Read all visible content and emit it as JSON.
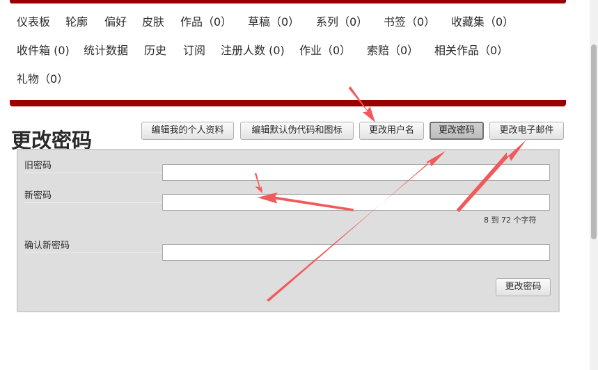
{
  "nav": {
    "row1": [
      "仪表板",
      "轮廓",
      "偏好",
      "皮肤",
      "作品（0）",
      "草稿（0）",
      "系列（0）",
      "书签（0）",
      "收藏集（0）"
    ],
    "row2": [
      "收件箱 (0)",
      "统计数据",
      "历史",
      "订阅",
      "注册人数 (0)",
      "作业（0）",
      "索赔（0）",
      "相关作品（0）"
    ],
    "row3": [
      "礼物（0）"
    ]
  },
  "page_title": "更改密码",
  "actions": {
    "edit_profile": "编辑我的个人资料",
    "edit_pseud": "编辑默认伪代码和图标",
    "change_username": "更改用户名",
    "change_password": "更改密码",
    "change_email": "更改电子邮件"
  },
  "form": {
    "old_password_label": "旧密码",
    "new_password_label": "新密码",
    "new_password_hint": "8 到 72 个字符",
    "confirm_password_label": "确认新密码",
    "submit_label": "更改密码"
  },
  "annotation_color": "#f05a5a",
  "accent_color": "#990000"
}
